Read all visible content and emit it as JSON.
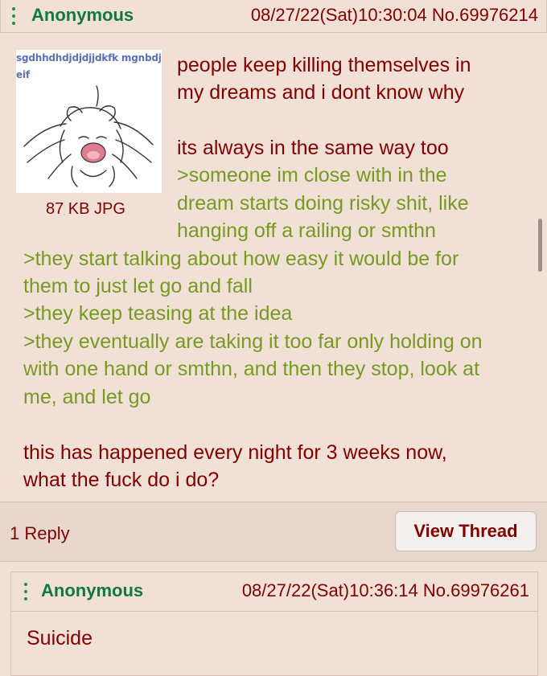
{
  "op": {
    "name": "Anonymous",
    "meta": "08/27/22(Sat)10:30:04 No.69976214",
    "image_caption": "sgdhhdhdjdjdjjdkfk mgnbdjeif",
    "file_info": "87 KB JPG",
    "lines": [
      {
        "text": "people keep killing themselves in",
        "green": false
      },
      {
        "text": "my dreams and i dont know why",
        "green": false
      },
      {
        "text": "its always in the same way too",
        "green": false
      },
      {
        "text": ">someone im close with in the",
        "green": true
      },
      {
        "text": "dream starts doing risky shit, like",
        "green": true
      },
      {
        "text": "hanging off a railing or smthn",
        "green": true
      },
      {
        "text": ">they start talking about how easy it would be for",
        "green": true
      },
      {
        "text": "them to just let go and fall",
        "green": true
      },
      {
        "text": ">they keep teasing at the idea",
        "green": true
      },
      {
        "text": ">they eventually are taking it too far only holding on",
        "green": true
      },
      {
        "text": "with one hand or smthn, and then they stop, look at",
        "green": true
      },
      {
        "text": "me, and let go",
        "green": true
      },
      {
        "text": "this has happened every night for 3 weeks now,",
        "green": false
      },
      {
        "text": "what the fuck do i do?",
        "green": false
      }
    ]
  },
  "footer": {
    "reply_count": "1 Reply",
    "view_thread": "View Thread"
  },
  "reply": {
    "name": "Anonymous",
    "meta": "08/27/22(Sat)10:36:14 No.69976261",
    "text": "Suicide"
  },
  "colors": {
    "background": "#f0e0d6",
    "name": "#117743",
    "text": "#800000",
    "greentext": "#789922"
  },
  "icons": [
    "menu-dots-icon",
    "thumbnail-image"
  ]
}
